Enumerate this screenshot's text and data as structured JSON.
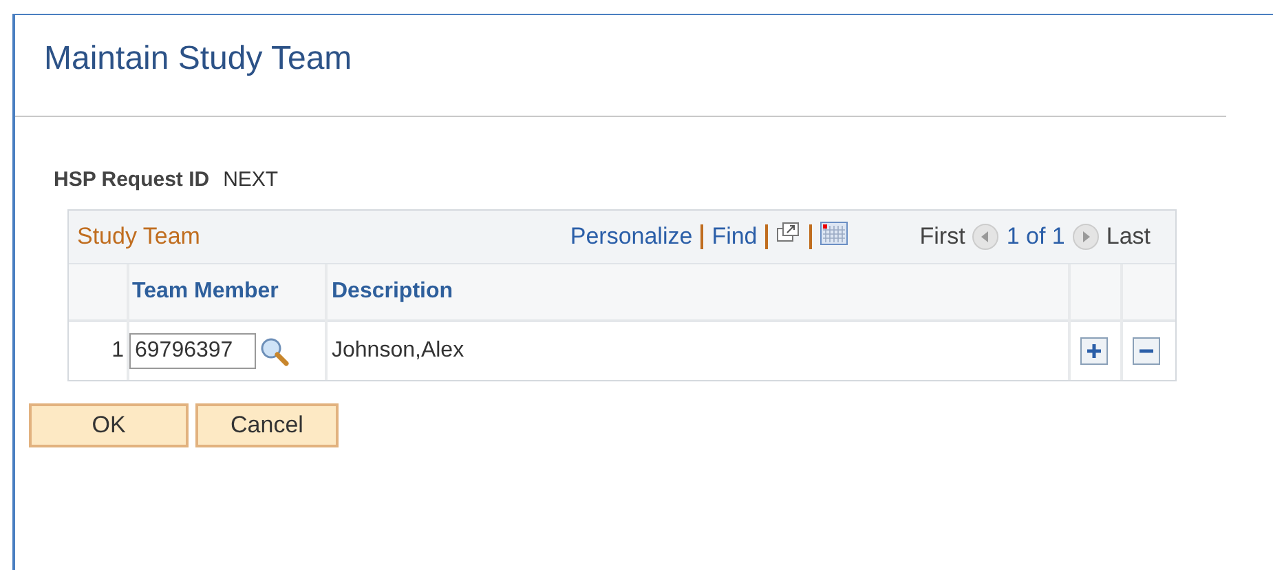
{
  "page": {
    "title": "Maintain Study Team"
  },
  "request": {
    "label": "HSP Request ID",
    "value": "NEXT"
  },
  "grid": {
    "title": "Study Team",
    "links": [
      "Personalize",
      "Find"
    ],
    "nav": {
      "first": "First",
      "count": "1 of 1",
      "last": "Last"
    },
    "columns": [
      "Team Member",
      "Description"
    ],
    "rows": [
      {
        "number": "1",
        "member": "69796397",
        "description": "Johnson,Alex"
      }
    ]
  },
  "buttons": [
    "OK",
    "Cancel"
  ]
}
